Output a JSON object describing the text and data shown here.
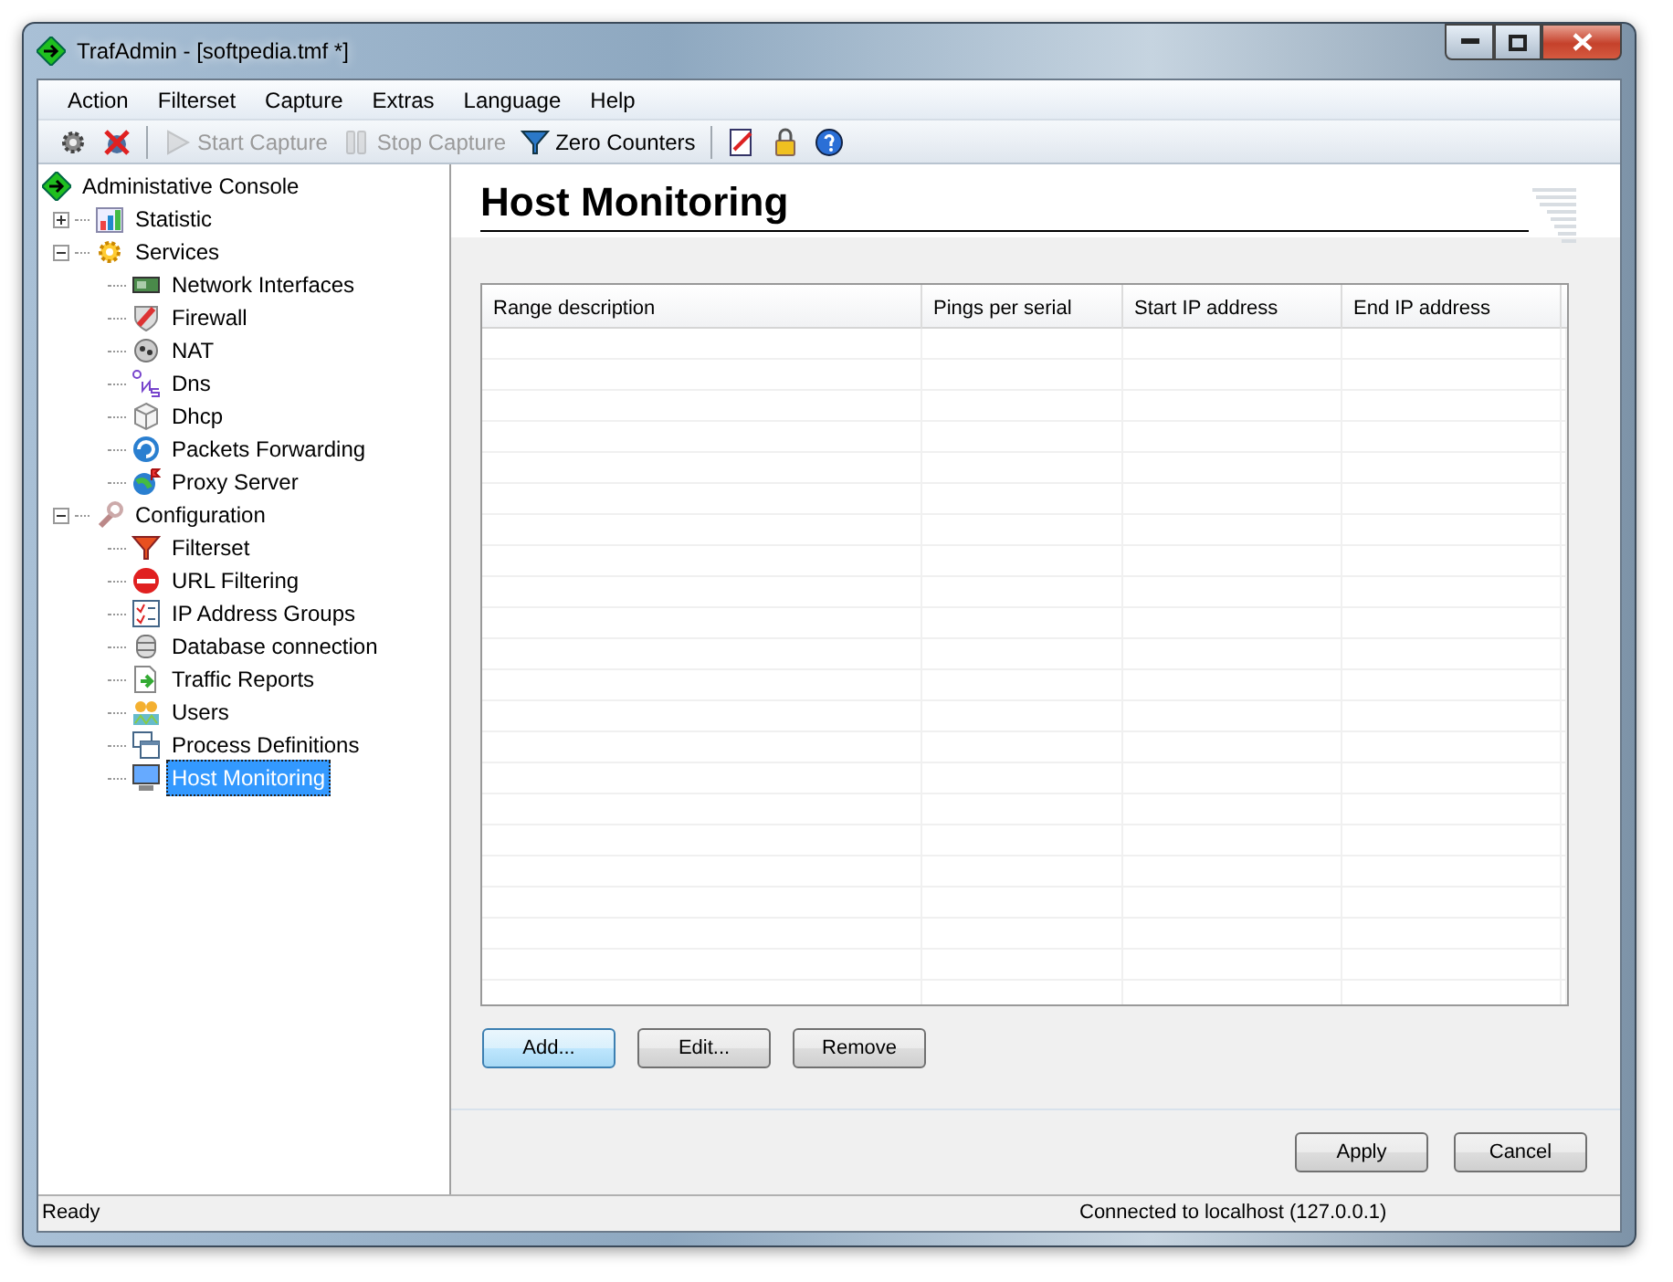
{
  "window": {
    "title": "TrafAdmin - [softpedia.tmf *]"
  },
  "menu": [
    "Action",
    "Filterset",
    "Capture",
    "Extras",
    "Language",
    "Help"
  ],
  "toolbar": [
    {
      "kind": "icon",
      "disabled": false
    },
    {
      "kind": "icon",
      "disabled": false
    },
    {
      "kind": "separator"
    },
    {
      "kind": "text",
      "label": "Start Capture",
      "disabled": true
    },
    {
      "kind": "text",
      "label": "Stop Capture",
      "disabled": true
    },
    {
      "kind": "text",
      "label": "Zero Counters",
      "disabled": false
    },
    {
      "kind": "separator"
    },
    {
      "kind": "icon",
      "disabled": false
    },
    {
      "kind": "icon",
      "disabled": false
    },
    {
      "kind": "icon",
      "disabled": false
    }
  ],
  "tree": {
    "label": "Administative Console",
    "selected": false,
    "children": [
      {
        "label": "Statistic",
        "selected": false,
        "expanded": false
      },
      {
        "label": "Services",
        "selected": false,
        "expanded": true,
        "children": [
          {
            "label": "Network Interfaces",
            "selected": false
          },
          {
            "label": "Firewall",
            "selected": false
          },
          {
            "label": "NAT",
            "selected": false
          },
          {
            "label": "Dns",
            "selected": false
          },
          {
            "label": "Dhcp",
            "selected": false
          },
          {
            "label": "Packets Forwarding",
            "selected": false
          },
          {
            "label": "Proxy Server",
            "selected": false
          }
        ]
      },
      {
        "label": "Configuration",
        "selected": false,
        "expanded": true,
        "children": [
          {
            "label": "Filterset",
            "selected": false
          },
          {
            "label": "URL Filtering",
            "selected": false
          },
          {
            "label": "IP Address Groups",
            "selected": false
          },
          {
            "label": "Database connection",
            "selected": false
          },
          {
            "label": "Traffic Reports",
            "selected": false
          },
          {
            "label": "Users",
            "selected": false
          },
          {
            "label": "Process Definitions",
            "selected": false
          },
          {
            "label": "Host Monitoring",
            "selected": true
          }
        ]
      }
    ]
  },
  "page": {
    "title": "Host Monitoring",
    "table": {
      "columns": [
        "Range description",
        "Pings per serial",
        "Start IP address",
        "End IP address"
      ]
    },
    "buttons": [
      {
        "label": "Add...",
        "default": true
      },
      {
        "label": "Edit...",
        "default": false
      },
      {
        "label": "Remove",
        "default": false
      }
    ],
    "footer_buttons": [
      "Apply",
      "Cancel"
    ]
  },
  "status_bar": [
    "Ready",
    "Connected to localhost (127.0.0.1)"
  ]
}
